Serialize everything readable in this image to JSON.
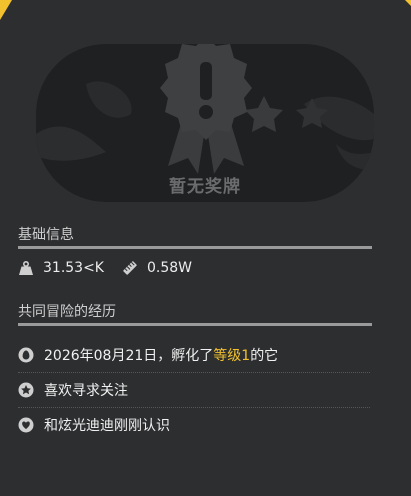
{
  "badge": {
    "empty_text": "暂无奖牌",
    "icon": "medal-exclamation-icon"
  },
  "basic_info": {
    "title": "基础信息",
    "weight": "31.53<K",
    "height": "0.58W",
    "weight_icon": "weight-icon",
    "height_icon": "ruler-icon"
  },
  "adventure": {
    "title": "共同冒险的经历",
    "rows": [
      {
        "icon": "egg-icon",
        "prefix": "2026年08月21日，孵化了",
        "highlight": "等级1",
        "suffix": "的它"
      },
      {
        "icon": "star-icon",
        "text": "喜欢寻求关注"
      },
      {
        "icon": "heart-icon",
        "text": "和炫光迪迪刚刚认识"
      }
    ]
  },
  "colors": {
    "background": "#2c2e30",
    "card": "#1f2021",
    "accent": "#f2c12e",
    "muted": "#6b6c6e"
  }
}
